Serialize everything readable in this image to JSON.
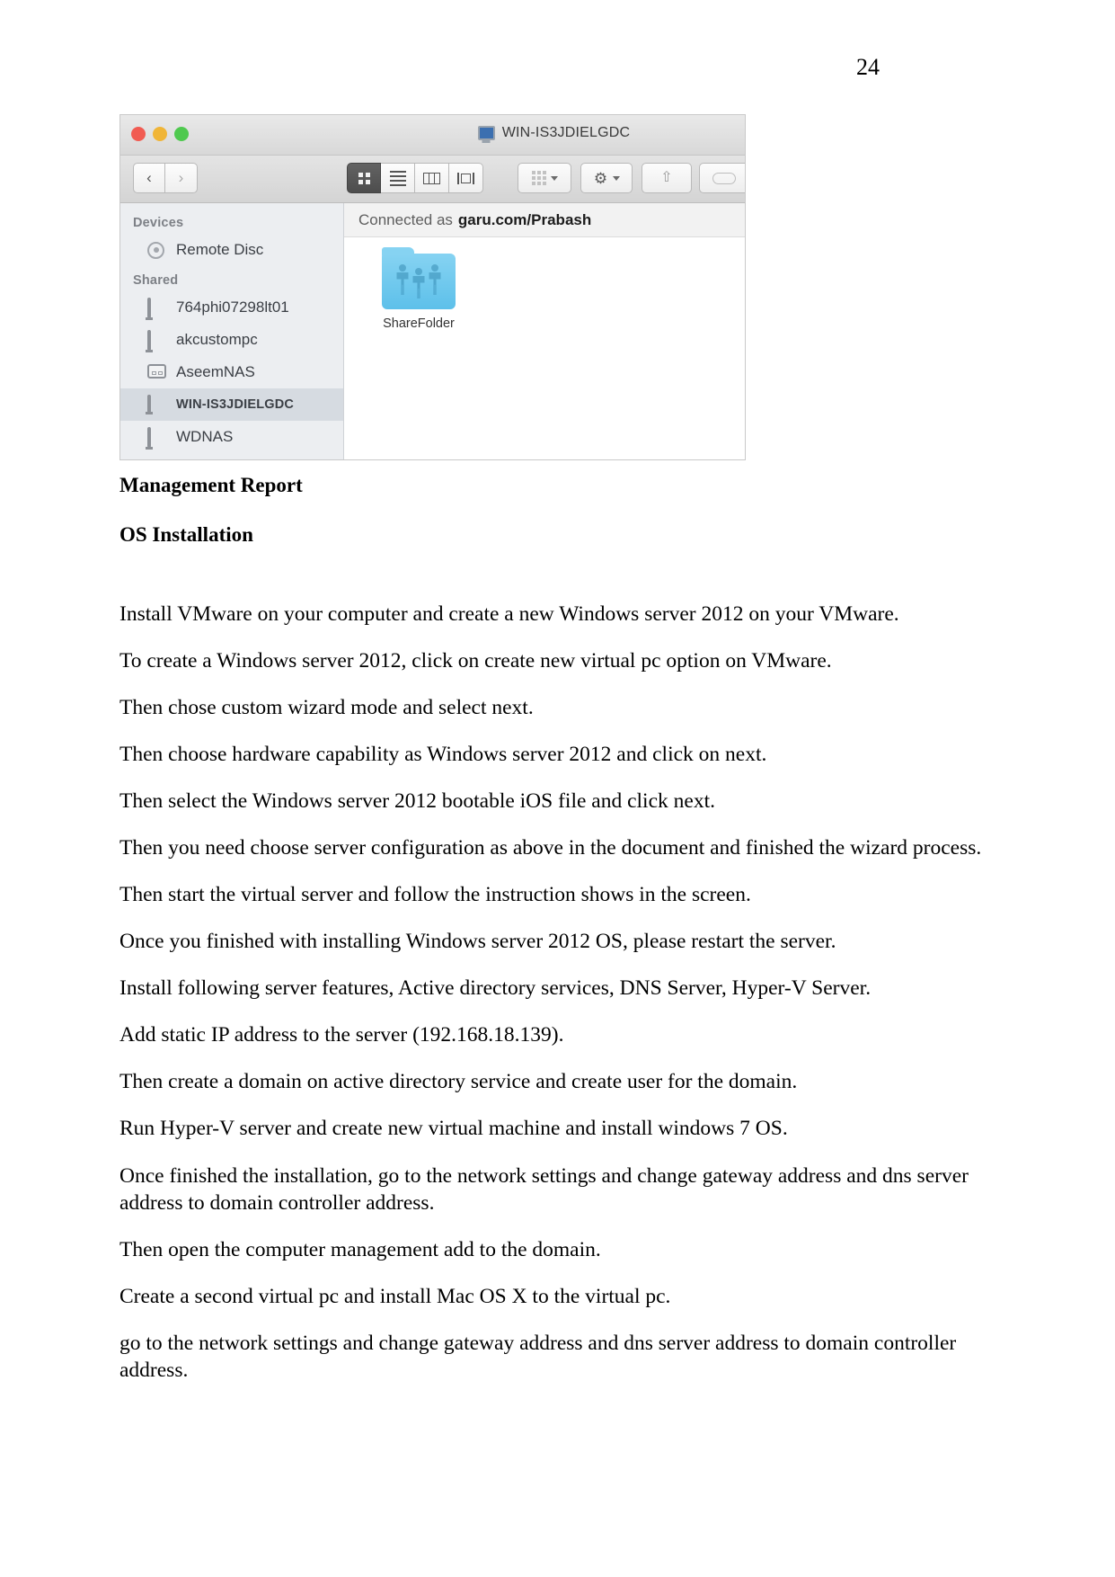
{
  "page": {
    "number": "24"
  },
  "finder": {
    "window_title": "WIN-IS3JDIELGDC",
    "title_icon": "monitor-icon",
    "traffic_lights": [
      "close",
      "minimize",
      "zoom"
    ],
    "toolbar": {
      "back_label": "‹",
      "forward_label": "›",
      "view_modes": [
        {
          "name": "icon-view",
          "active": true
        },
        {
          "name": "list-view",
          "active": false
        },
        {
          "name": "column-view",
          "active": false
        },
        {
          "name": "coverflow-view",
          "active": false
        }
      ],
      "arrange_label": "arrange-button",
      "action_label": "action-gear-button",
      "share_label": "share-button",
      "tags_label": "tags-button"
    },
    "connected_bar": {
      "prefix": "Connected as",
      "user": "garu.com/Prabash"
    },
    "sidebar": {
      "sections": [
        {
          "header": "Devices",
          "items": [
            {
              "label": "Remote Disc",
              "icon": "disc-icon",
              "selected": false
            }
          ]
        },
        {
          "header": "Shared",
          "items": [
            {
              "label": "764phi07298lt01",
              "icon": "monitor-icon",
              "selected": false
            },
            {
              "label": "akcustompc",
              "icon": "monitor-icon",
              "selected": false
            },
            {
              "label": "AseemNAS",
              "icon": "nas-icon",
              "selected": false
            },
            {
              "label": "WIN-IS3JDIELGDC",
              "icon": "monitor-icon",
              "selected": true
            },
            {
              "label": "WDNAS",
              "icon": "monitor-icon",
              "selected": false
            }
          ]
        }
      ]
    },
    "files": [
      {
        "label": "ShareFolder",
        "icon": "shared-folder-icon"
      }
    ],
    "colors": {
      "folder_blue": "#5dc0ea",
      "selection": "#d6dbe1",
      "sidebar_bg": "#eceef1"
    }
  },
  "document": {
    "heading1": "Management Report",
    "heading2": "OS Installation",
    "paragraphs": [
      "Install VMware on your computer and create a new Windows server 2012 on your VMware.",
      "To create a Windows server 2012, click on create new virtual pc option on VMware.",
      "Then chose custom wizard mode and select next.",
      "Then choose hardware capability as Windows server 2012 and click on next.",
      " Then select the Windows server 2012 bootable iOS file and click next.",
      "Then you need choose server configuration as above in the document and finished the wizard process.",
      "Then start the virtual server and follow the instruction shows in the screen.",
      "Once you finished with installing Windows server 2012 OS, please restart the server.",
      "Install following server features, Active directory services, DNS Server, Hyper-V Server.",
      "Add static IP address to the server (192.168.18.139).",
      "Then create a domain on active directory service and create user for the domain.",
      "Run Hyper-V server and create new virtual machine and install windows 7 OS.",
      "Once finished the installation, go to the network settings and change gateway address and dns server address to domain controller address.",
      "Then open the computer management add to the domain.",
      "Create a second virtual pc and install Mac OS X to the virtual pc.",
      " go to the network settings and change gateway address and dns server address to domain controller address."
    ]
  }
}
